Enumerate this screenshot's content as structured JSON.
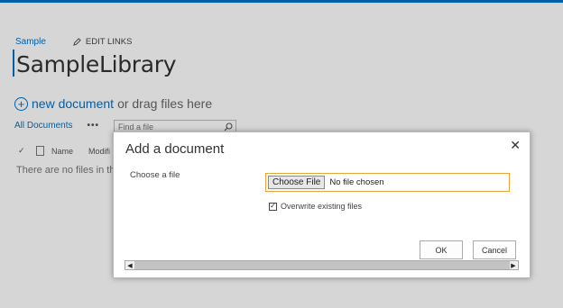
{
  "background": {
    "breadcrumb": "Sample",
    "edit_links": "EDIT LINKS",
    "page_title": "SampleLibrary",
    "new_document": "new document",
    "drag_text": "or drag files here",
    "view_name": "All Documents",
    "more": "•••",
    "search_placeholder": "Find a file",
    "columns": {
      "name": "Name",
      "modified": "Modifi"
    },
    "empty_message": "There are no files in th"
  },
  "dialog": {
    "title": "Add a document",
    "close": "✕",
    "choose_label": "Choose a file",
    "choose_button": "Choose File",
    "no_file_text": "No file chosen",
    "overwrite_label": "Overwrite existing files",
    "overwrite_checked": true,
    "ok_label": "OK",
    "cancel_label": "Cancel"
  },
  "colors": {
    "accent": "#0072c6",
    "focus_border": "#e8a33b"
  },
  "icons": [
    "pencil-icon",
    "plus-circle-icon",
    "search-icon",
    "check-icon",
    "file-icon",
    "close-icon",
    "scroll-left-icon",
    "scroll-right-icon"
  ]
}
